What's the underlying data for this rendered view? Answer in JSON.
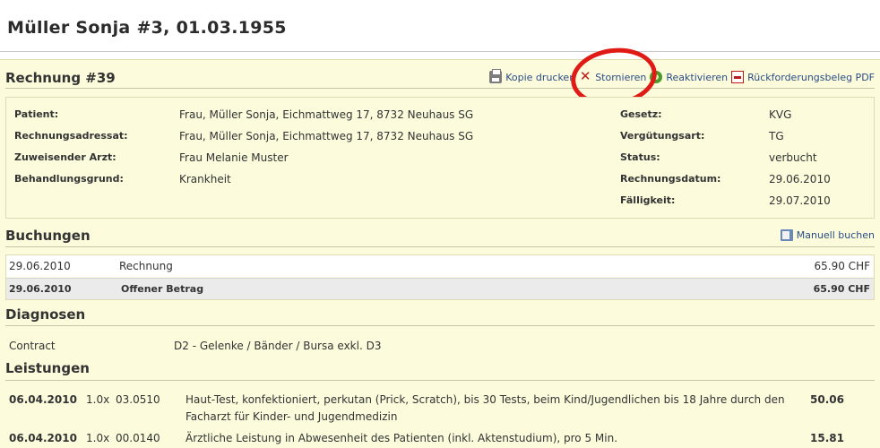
{
  "patient_header": {
    "title": "Müller Sonja #3, 01.03.1955"
  },
  "invoice": {
    "title": "Rechnung #39",
    "actions": [
      {
        "label": "Kopie drucken",
        "icon": "printer-icon"
      },
      {
        "label": "Stornieren",
        "icon": "cancel-x-icon"
      },
      {
        "label": "Reaktivieren",
        "icon": "reactivate-icon"
      },
      {
        "label": "Rückforderungsbeleg PDF",
        "icon": "pdf-icon"
      }
    ],
    "left_fields": [
      {
        "label": "Patient:",
        "value": "Frau, Müller Sonja, Eichmattweg 17, 8732 Neuhaus SG"
      },
      {
        "label": "Rechnungsadressat:",
        "value": "Frau, Müller Sonja, Eichmattweg 17, 8732 Neuhaus SG"
      },
      {
        "label": "Zuweisender Arzt:",
        "value": "Frau Melanie Muster"
      },
      {
        "label": "Behandlungsgrund:",
        "value": "Krankheit"
      }
    ],
    "right_fields": [
      {
        "label": "Gesetz:",
        "value": "KVG"
      },
      {
        "label": "Vergütungsart:",
        "value": "TG"
      },
      {
        "label": "Status:",
        "value": "verbucht"
      },
      {
        "label": "Rechnungsdatum:",
        "value": "29.06.2010"
      },
      {
        "label": "Fälligkeit:",
        "value": "29.07.2010"
      }
    ]
  },
  "bookings": {
    "title": "Buchungen",
    "manual_link": "Manuell buchen",
    "rows": [
      {
        "date": "29.06.2010",
        "text": "Rechnung",
        "amount": "65.90 CHF"
      },
      {
        "date": "29.06.2010",
        "text": "Offener Betrag",
        "amount": "65.90 CHF"
      }
    ]
  },
  "diagnoses": {
    "title": "Diagnosen",
    "rows": [
      {
        "type": "Contract",
        "text": "D2 - Gelenke / Bänder / Bursa exkl. D3"
      }
    ]
  },
  "services": {
    "title": "Leistungen",
    "rows": [
      {
        "date": "06.04.2010",
        "qty": "1.0x",
        "code": "03.0510",
        "text_line1": "Haut-Test, konfektioniert, perkutan (Prick, Scratch), bis 30 Tests, beim Kind/Jugendlichen bis 18 Jahre durch den",
        "text_line2": "Facharzt für Kinder- und Jugendmedizin",
        "amount": "50.06"
      },
      {
        "date": "06.04.2010",
        "qty": "1.0x",
        "code": "00.0140",
        "text_line1": "Ärztliche Leistung in Abwesenheit des Patienten (inkl. Aktenstudium), pro 5 Min.",
        "text_line2": "",
        "amount": "15.81"
      }
    ]
  },
  "annotation": {
    "color": "#e01b16"
  }
}
